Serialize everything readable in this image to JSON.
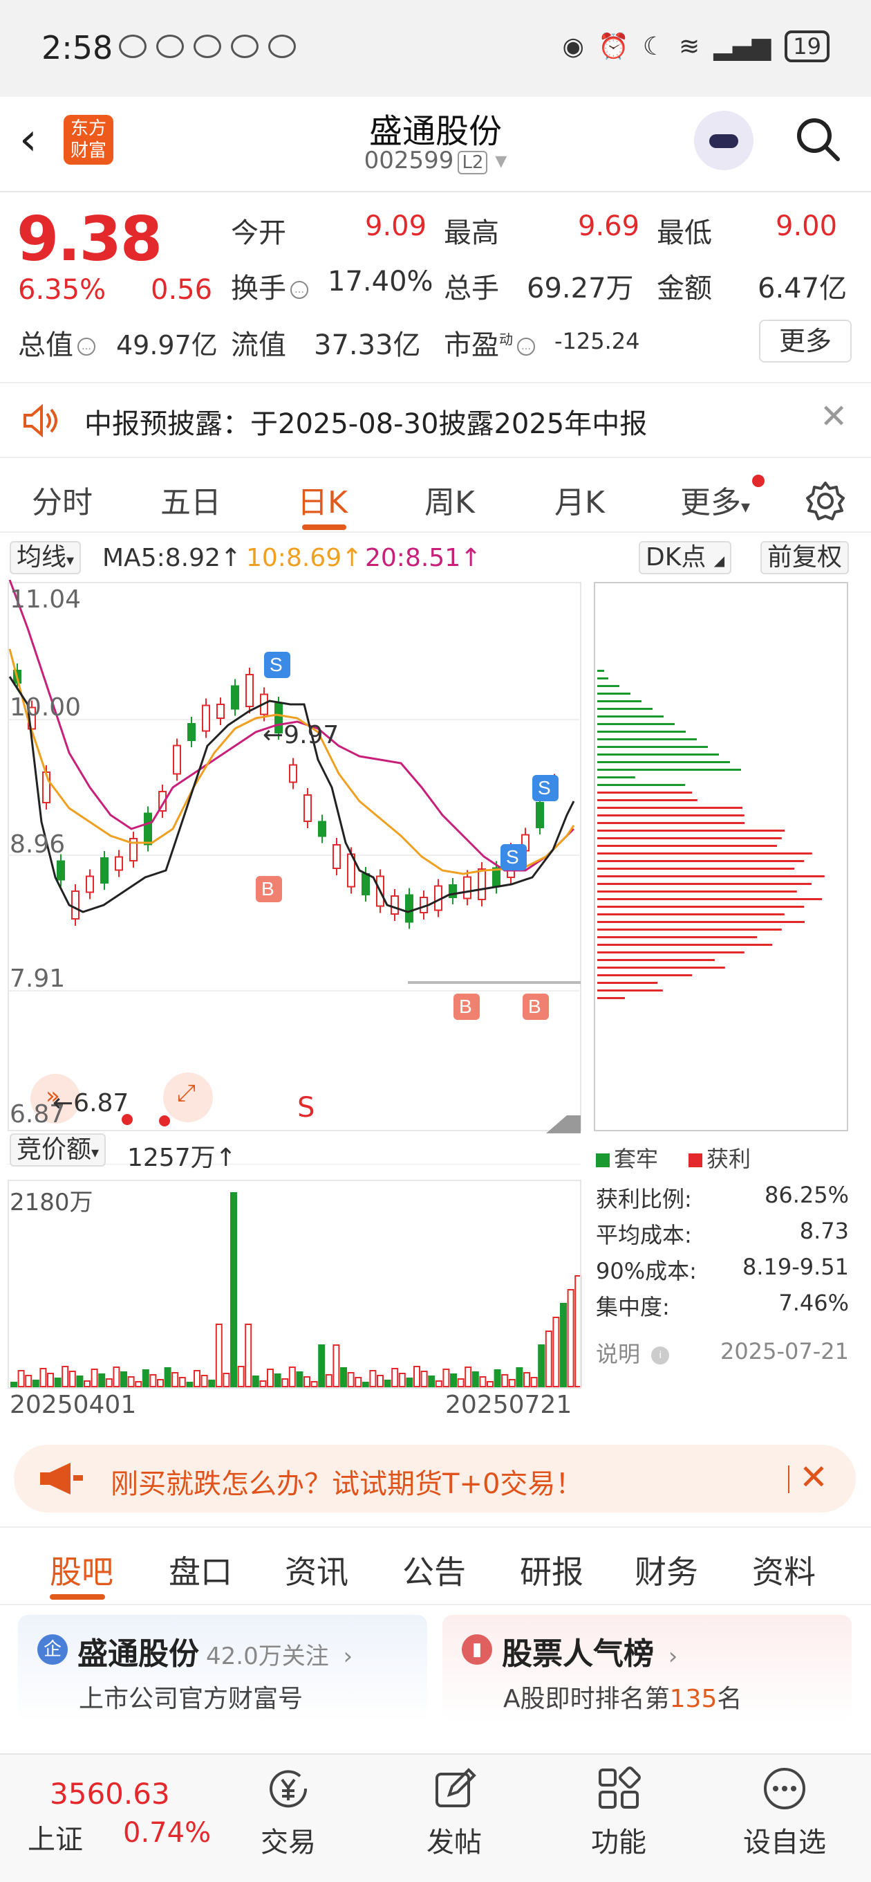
{
  "status": {
    "time": "2:58",
    "battery": "19"
  },
  "header": {
    "back": "‹",
    "logo_line1": "东方",
    "logo_line2": "财富",
    "title": "盛通股份",
    "code": "002599",
    "level": "L2"
  },
  "quote": {
    "price": "9.38",
    "change_pct": "6.35%",
    "change": "0.56",
    "open_label": "今开",
    "open": "9.09",
    "high_label": "最高",
    "high": "9.69",
    "low_label": "最低",
    "low": "9.00",
    "turnover_label": "换手",
    "turnover": "17.40%",
    "volume_label": "总手",
    "volume": "69.27万",
    "amount_label": "金额",
    "amount": "6.47亿",
    "mcap_label": "总值",
    "mcap": "49.97亿",
    "float_label": "流值",
    "float": "37.33亿",
    "pe_label": "市盈",
    "pe_sup": "动",
    "pe": "-125.24",
    "more": "更多"
  },
  "notice": {
    "text": "中报预披露：于2025-08-30披露2025年中报"
  },
  "ktabs": [
    "分时",
    "五日",
    "日K",
    "周K",
    "月K",
    "更多"
  ],
  "marow": {
    "ma_select": "均线",
    "ma5": "MA5:8.92↑",
    "ma10": "10:8.69↑",
    "ma20": "20:8.51↑",
    "dk": "DK点",
    "fq": "前复权"
  },
  "chart": {
    "y_labels": [
      "11.04",
      "10.00",
      "8.96",
      "7.91",
      "6.87"
    ],
    "hi_label": "9.97",
    "lo_label": "6.87",
    "s_marker": "S",
    "vol_select": "竞价额",
    "vol_value": "1257万↑",
    "vol_max": "2180万",
    "date_start": "20250401",
    "date_end": "20250721",
    "legend_trapped": "套牢",
    "legend_profit": "获利",
    "stats": [
      {
        "k": "获利比例:",
        "v": "86.25%"
      },
      {
        "k": "平均成本:",
        "v": "8.73"
      },
      {
        "k": "90%成本:",
        "v": "8.19-9.51"
      },
      {
        "k": "集中度:",
        "v": "7.46%"
      }
    ],
    "note": "说明",
    "note_date": "2025-07-21",
    "colors": {
      "up": "#e4292c",
      "down": "#1a9a2e",
      "ma5": "#222222",
      "ma10": "#f0a020",
      "ma20": "#c8207a"
    }
  },
  "ad": {
    "text": "刚买就跌怎么办？试试期货T+0交易！"
  },
  "btabs": [
    "股吧",
    "盘口",
    "资讯",
    "公告",
    "研报",
    "财务",
    "资料"
  ],
  "cards": {
    "c1_title": "盛通股份",
    "c1_follow": "42.0万关注",
    "c1_sub": "上市公司官方财富号",
    "c2_title": "股票人气榜",
    "c2_sub1": "A股即时排名第",
    "c2_rank": "135",
    "c2_sub2": "名"
  },
  "bottom": {
    "index_value": "3560.63",
    "index_name": "上证",
    "index_pct": "0.74%",
    "nav": [
      "交易",
      "发帖",
      "功能",
      "设自选"
    ]
  }
}
